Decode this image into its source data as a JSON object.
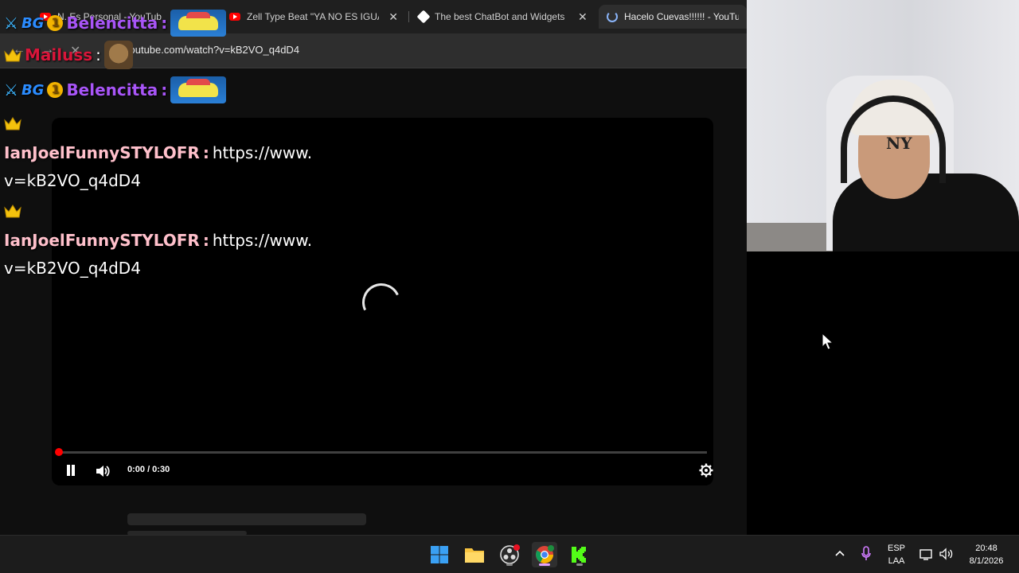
{
  "browser": {
    "tabs": [
      {
        "title": "N. Es Personal - YouTub",
        "favicon": "youtube-icon",
        "active": false
      },
      {
        "title": "Zell Type Beat \"YA NO ES IGUAL",
        "favicon": "youtube-icon",
        "active": false
      },
      {
        "title": "The best ChatBot and Widgets",
        "favicon": "streamelements-icon",
        "active": false
      },
      {
        "title": "Hacelo Cuevas!!!!!! - YouTube",
        "favicon": "loading-icon",
        "active": true
      }
    ],
    "close_glyph": "✕",
    "url": "youtube.com/watch?v=kB2VO_q4dD4"
  },
  "player": {
    "time_display": "0:00 / 0:30",
    "progress": 0.0,
    "state": "loading"
  },
  "chat": {
    "messages": [
      {
        "user": "Belencitta",
        "separator": ":",
        "color": "#a855f7",
        "content": "car-emote"
      },
      {
        "user": "Mailuss",
        "separator": ":",
        "color": "#d9163a",
        "content": "otter-emote"
      },
      {
        "user": "Belencitta",
        "separator": ":",
        "color": "#a855f7",
        "content": "car-emote"
      },
      {
        "user": "IanJoelFunnySTYLOFR",
        "separator": ":",
        "color": "#ffc0cb",
        "text_line1": "https://www.",
        "text_line2": "v=kB2VO_q4dD4"
      },
      {
        "user": "IanJoelFunnySTYLOFR",
        "separator": ":",
        "color": "#ffc0cb",
        "text_line1": "https://www.",
        "text_line2": "v=kB2VO_q4dD4"
      }
    ],
    "badge_bg": "BG",
    "badge_coin": "1"
  },
  "taskbar": {
    "apps": [
      "windows-start-icon",
      "file-explorer-icon",
      "obs-icon",
      "chrome-icon",
      "kick-icon"
    ],
    "lang_primary": "ESP",
    "lang_secondary": "LAA",
    "time": "20:48",
    "date": "8/1/2026"
  },
  "colors": {
    "accent_red": "#ff0000",
    "kick_green": "#53fc18",
    "chat_purple": "#a855f7"
  }
}
